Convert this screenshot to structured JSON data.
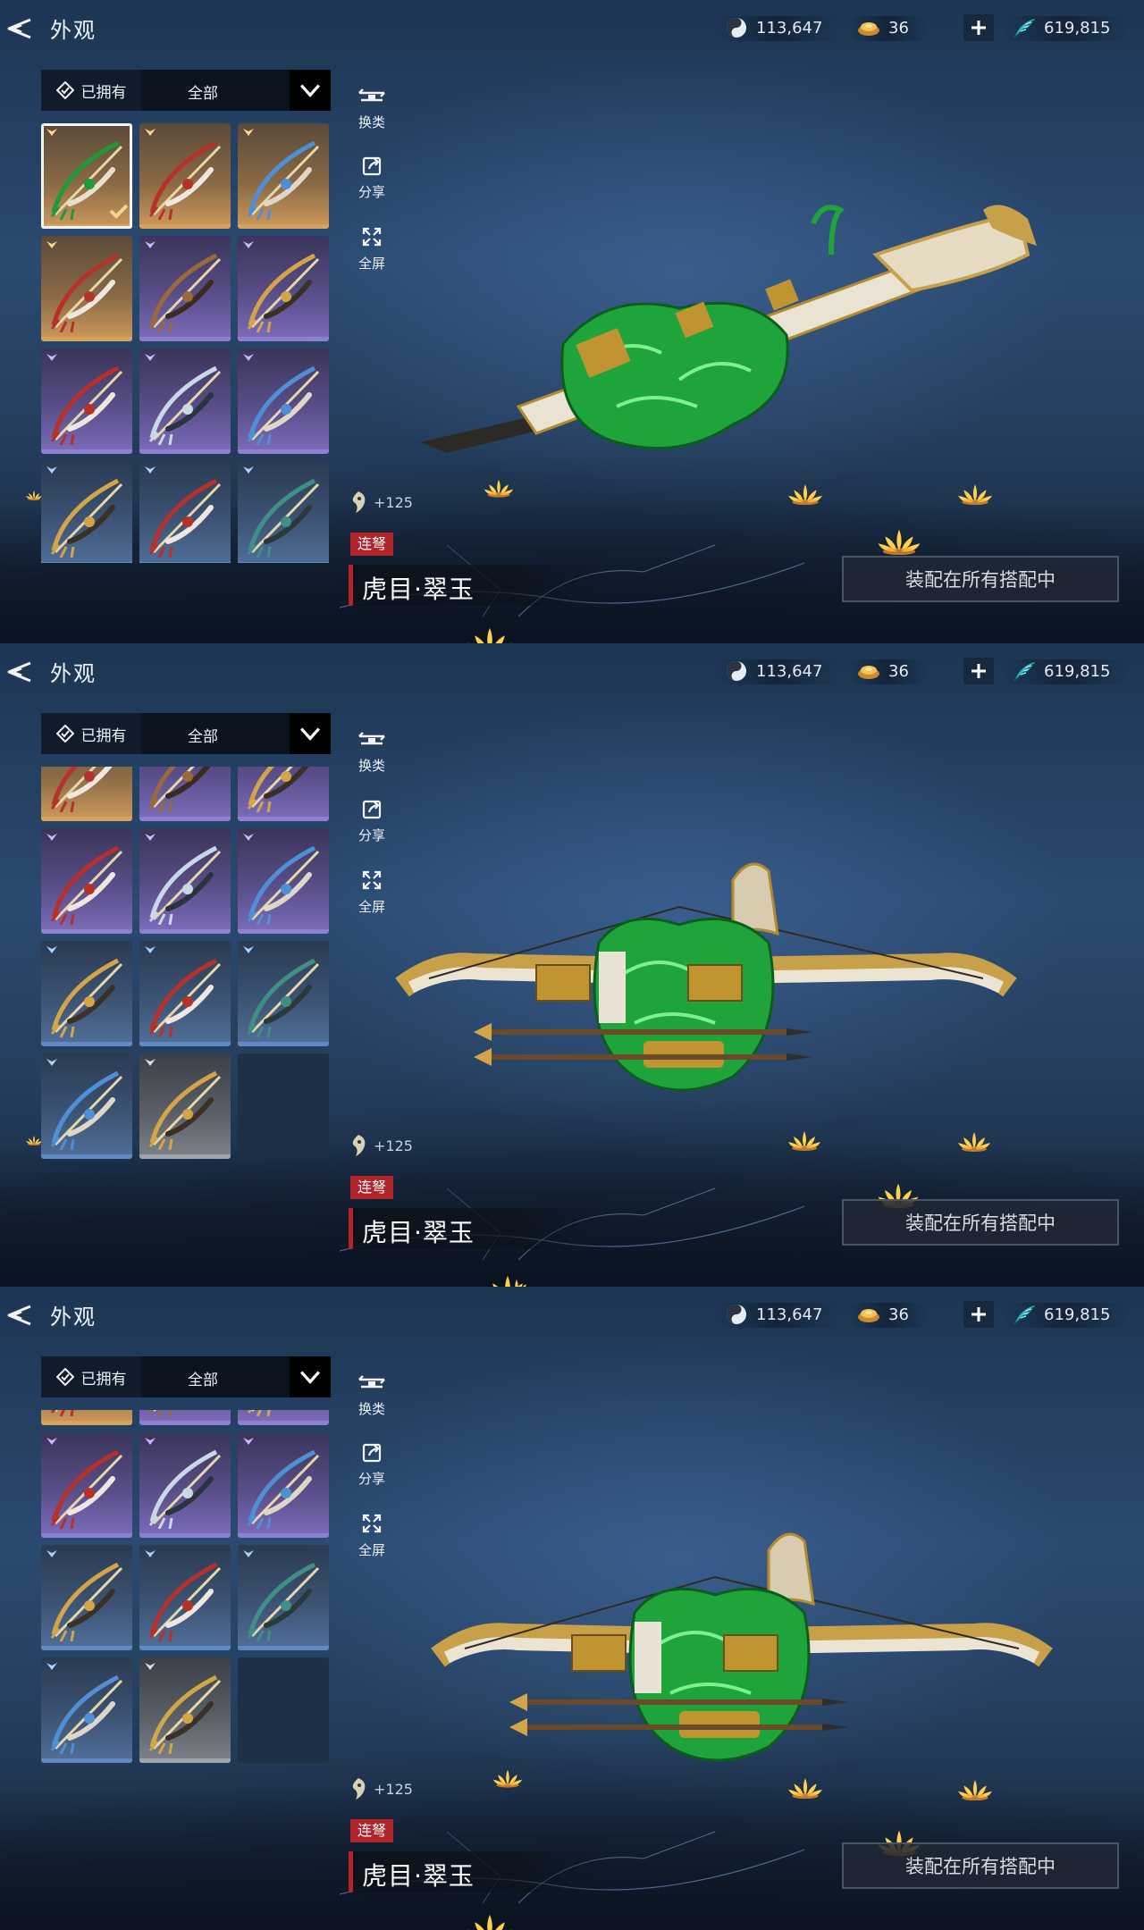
{
  "header": {
    "title": "外观"
  },
  "currencies": [
    {
      "icon": "jade-orb-icon",
      "value": "113,647"
    },
    {
      "icon": "gold-ingot-icon",
      "value": "36"
    },
    {
      "icon": "feather-token-icon",
      "value": "619,815"
    }
  ],
  "filter": {
    "owned_label": "已拥有",
    "category_label": "全部"
  },
  "side_actions": [
    {
      "icon": "swap-weapon-icon",
      "label": "换类"
    },
    {
      "icon": "share-icon",
      "label": "分享"
    },
    {
      "icon": "fullscreen-icon",
      "label": "全屏"
    }
  ],
  "item": {
    "score": "+125",
    "type": "连弩",
    "name": "虎目·翠玉",
    "equip_label": "装配在所有搭配中"
  },
  "colors": {
    "accent_red": "#b3242a",
    "gold_rarity": "#d6a25c",
    "purple_rarity": "#8f7fd0",
    "blue_rarity": "#5f8ac4"
  },
  "skins": [
    {
      "rarity": "gold",
      "tone": "green",
      "selected": true
    },
    {
      "rarity": "gold",
      "tone": "red"
    },
    {
      "rarity": "gold",
      "tone": "blue"
    },
    {
      "rarity": "gold",
      "tone": "red"
    },
    {
      "rarity": "purple",
      "tone": "bronze"
    },
    {
      "rarity": "purple",
      "tone": "gold"
    },
    {
      "rarity": "purple",
      "tone": "red"
    },
    {
      "rarity": "purple",
      "tone": "silver"
    },
    {
      "rarity": "purple",
      "tone": "blue"
    },
    {
      "rarity": "blue",
      "tone": "gold"
    },
    {
      "rarity": "blue",
      "tone": "red"
    },
    {
      "rarity": "blue",
      "tone": "teal"
    },
    {
      "rarity": "blue",
      "tone": "blue"
    },
    {
      "rarity": "grey",
      "tone": "gold"
    },
    {
      "rarity": "empty",
      "tone": ""
    }
  ],
  "panels": [
    {
      "view": "side",
      "scroll_rows": 0
    },
    {
      "view": "front",
      "scroll_rows": 1.45
    },
    {
      "view": "front-rotated",
      "scroll_rows": 1.8
    }
  ]
}
